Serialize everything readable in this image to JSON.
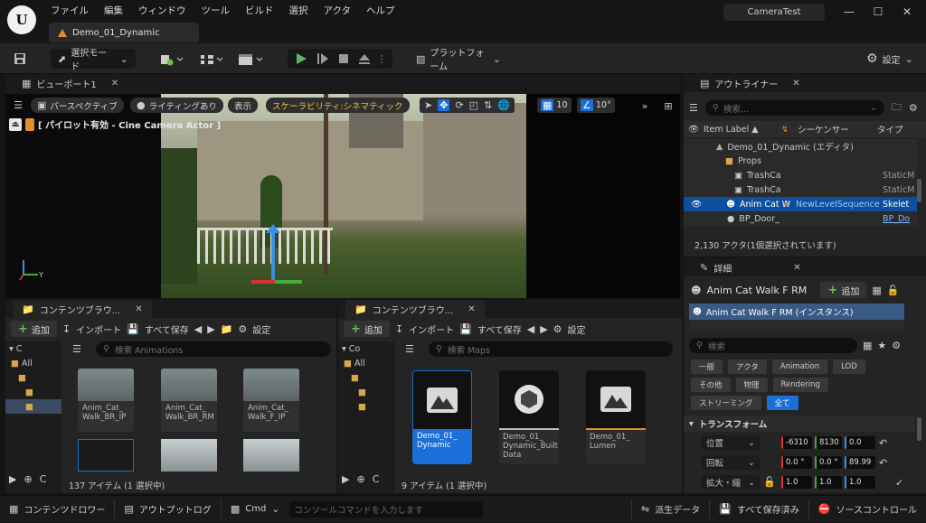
{
  "menu": [
    "ファイル",
    "編集",
    "ウィンドウ",
    "ツール",
    "ビルド",
    "選択",
    "アクタ",
    "ヘルプ"
  ],
  "project_name": "CameraTest",
  "doc_tab": "Demo_01_Dynamic",
  "toolbar": {
    "select_mode": "選択モード",
    "platform": "プラットフォーム",
    "settings": "設定"
  },
  "viewport": {
    "tab": "ビューポート1",
    "perspective": "パースペクティブ",
    "lighting": "ライティングあり",
    "show": "表示",
    "scalability": "スケーラビリティ:シネマティック",
    "grid_snap": "10",
    "angle_snap": "10°",
    "pilot_label": "[ パイロット有効 - Cine Camera Actor ]"
  },
  "content1": {
    "tab": "コンテンツブラウ...",
    "add": "追加",
    "import": "インポート",
    "save_all": "すべて保存",
    "settings": "設定",
    "search_placeholder": "検索 Animations",
    "tree_label": "C",
    "tree_all": "All",
    "items": [
      {
        "name": "Anim_Cat_ Walk_BR_IP"
      },
      {
        "name": "Anim_Cat_ Walk_BR_RM"
      },
      {
        "name": "Anim_Cat_ Walk_F_IP"
      }
    ],
    "count": "137 アイテム (1 選択中)"
  },
  "content2": {
    "tab": "コンテンツブラウ...",
    "add": "追加",
    "import": "インポート",
    "save_all": "すべて保存",
    "settings": "設定",
    "search_placeholder": "検索 Maps",
    "tree_label": "Co",
    "tree_all": "All",
    "items": [
      {
        "name": "Demo_01_ Dynamic"
      },
      {
        "name": "Demo_01_ Dynamic_Built Data"
      },
      {
        "name": "Demo_01_ Lumen"
      }
    ],
    "count": "9 アイテム (1 選択中)"
  },
  "outliner": {
    "tab": "アウトライナー",
    "search_placeholder": "検索...",
    "col_label": "Item Label ▲",
    "col_sequencer": "シーケンサー",
    "col_type": "タイプ",
    "rows": [
      {
        "label": "Demo_01_Dynamic (エディタ)",
        "seq": "",
        "type": ""
      },
      {
        "label": "Props",
        "seq": "",
        "type": ""
      },
      {
        "label": "TrashCa",
        "seq": "",
        "type": "StaticM"
      },
      {
        "label": "TrashCa",
        "seq": "",
        "type": "StaticM"
      },
      {
        "label": "Anim Cat W",
        "seq": "NewLevelSequence",
        "type": "Skelet"
      },
      {
        "label": "BP_Door_",
        "seq": "",
        "type": "BP_Do"
      }
    ],
    "footer": "2,130 アクタ(1個選択されています)"
  },
  "details": {
    "tab": "詳細",
    "actor_name": "Anim Cat Walk F RM",
    "add": "追加",
    "instance": "Anim Cat Walk F RM (インスタンス)",
    "search_placeholder": "検索",
    "categories": [
      "一般",
      "アクタ",
      "Animation",
      "LOD",
      "その他",
      "物理",
      "Rendering",
      "ストリーミング",
      "全て"
    ],
    "section": "トランスフォーム",
    "location_label": "位置",
    "rotation_label": "回転",
    "scale_label": "拡大・縮",
    "location": [
      "-6310",
      "8130",
      "0.0"
    ],
    "rotation": [
      "0.0 °",
      "0.0 °",
      "89.99"
    ],
    "scale": [
      "1.0",
      "1.0",
      "1.0"
    ]
  },
  "statusbar": {
    "drawer": "コンテンツドロワー",
    "output_log": "アウトプットログ",
    "cmd": "Cmd",
    "cmd_placeholder": "コンソールコマンドを入力します",
    "derived": "派生データ",
    "all_saved": "すべて保存済み",
    "source_control": "ソースコントロール"
  },
  "colors": {
    "accent_blue": "#1a6fd8",
    "selection": "#0d4f9e",
    "play_green": "#5cb85c",
    "orange": "#e0902a"
  }
}
